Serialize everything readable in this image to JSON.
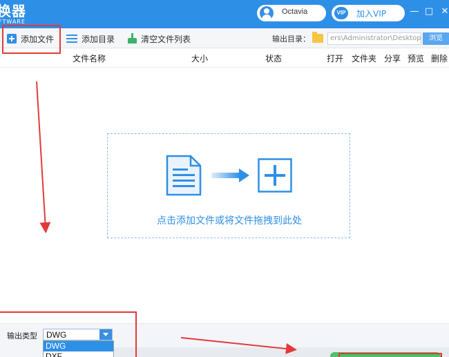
{
  "window": {
    "title": "换器",
    "subtitle": "FTWARE",
    "user": {
      "name": "Octavia"
    },
    "vip": {
      "badge": "VIP",
      "label": "加入VIP"
    },
    "controls": {
      "minimize": "—",
      "maximize": "□",
      "close": "✕"
    }
  },
  "toolbar": {
    "add_file": "添加文件",
    "add_dir": "添加目录",
    "clear_list": "清空文件列表",
    "output_label": "输出目录：",
    "output_path": "ers\\Administrator\\Desktop",
    "browse": "浏览"
  },
  "columns": [
    "文件名称",
    "大小",
    "状态",
    "打开",
    "文件夹",
    "分享",
    "预览",
    "删除"
  ],
  "dropzone": {
    "hint": "点击添加文件或将文件拖拽到此处"
  },
  "output_type": {
    "label": "输出类型",
    "selected": "DWG",
    "options": [
      "DWG",
      "DXF"
    ]
  },
  "colors": {
    "accent": "#2e8fe6",
    "annotation_red": "#e23a3a",
    "convert_green": "#4fc06b"
  },
  "icons": [
    "add-file-icon",
    "list-icon",
    "broom-icon",
    "folder-icon",
    "document-icon",
    "arrow-right-icon",
    "plus-box-icon",
    "avatar",
    "vip-icon"
  ]
}
